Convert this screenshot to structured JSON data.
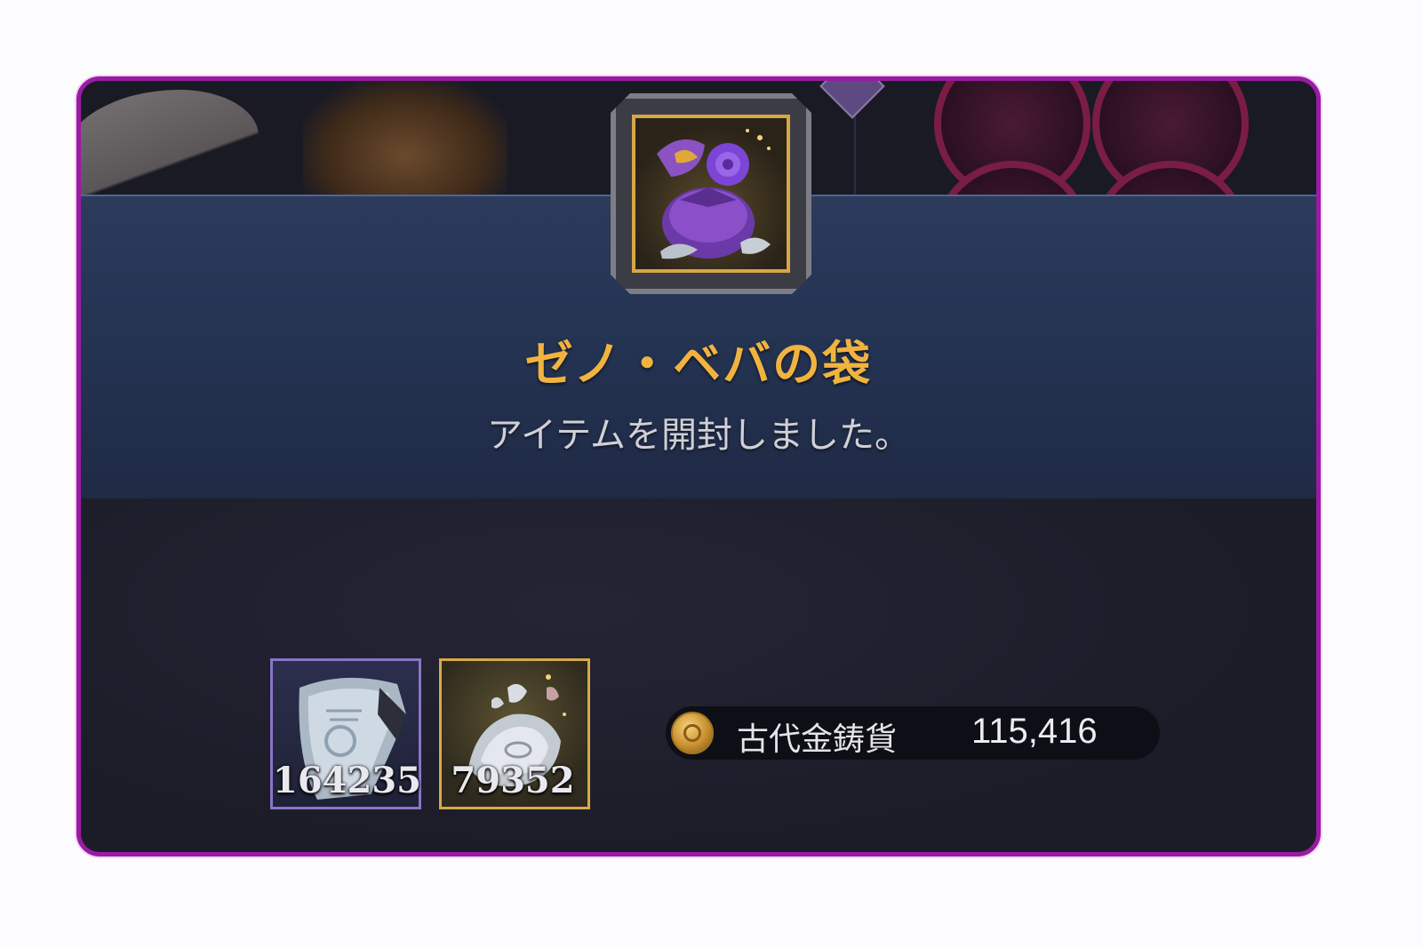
{
  "dialog": {
    "item_name": "ゼノ・ベバの袋",
    "message": "アイテムを開封しました。",
    "item_icon": "purple-flower-pouch-icon"
  },
  "rewards": [
    {
      "icon": "silver-armor-fragment-icon",
      "count": "164235",
      "rarity_color": "#8a74c8"
    },
    {
      "icon": "silver-ore-fragment-icon",
      "count": "79352",
      "rarity_color": "#d6a94c"
    }
  ],
  "currency": {
    "icon": "gold-coin-icon",
    "label": "古代金鋳貨",
    "value": "115,416"
  },
  "colors": {
    "frame_border": "#9b1aa6",
    "title": "#f0b340",
    "panel": "#243352"
  }
}
